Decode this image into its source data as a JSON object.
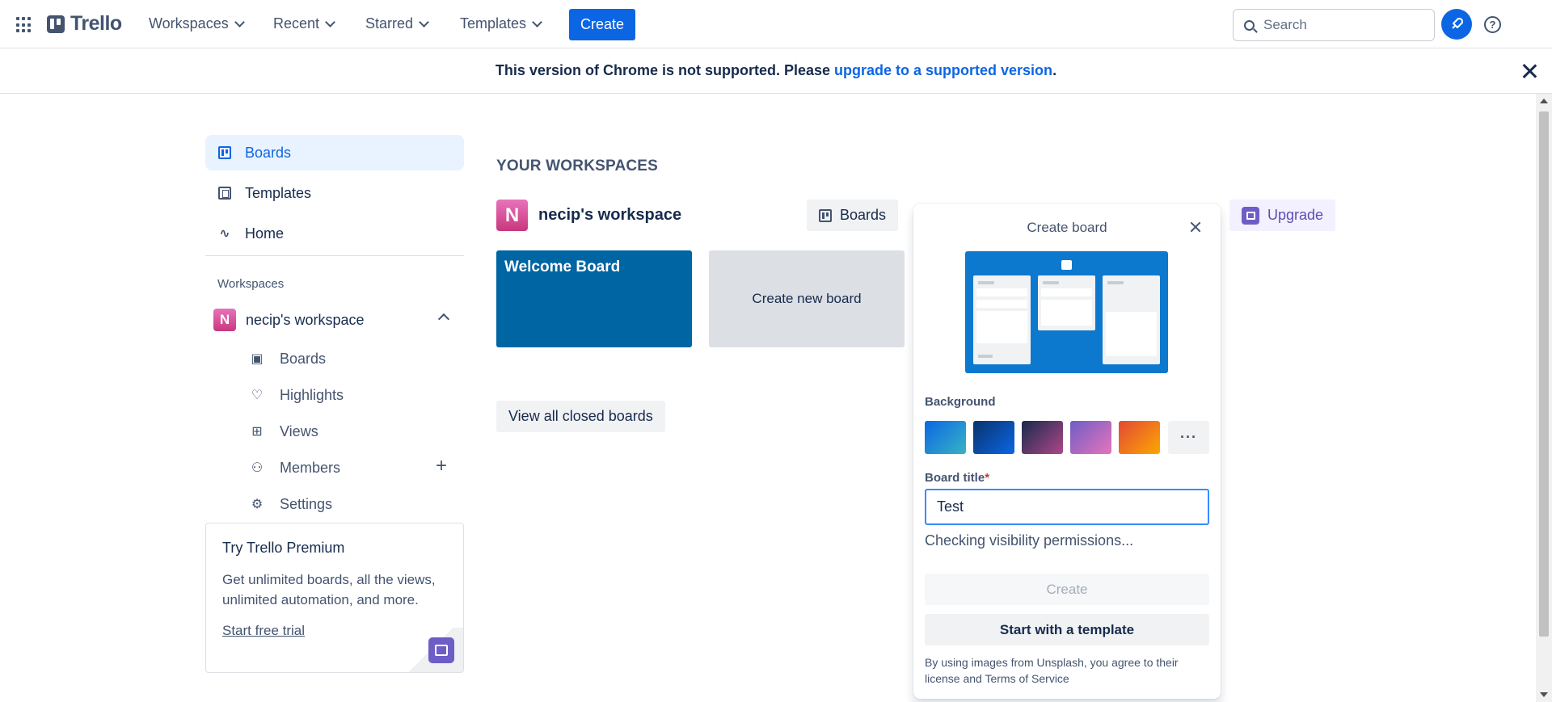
{
  "header": {
    "logo_text": "Trello",
    "nav": [
      "Workspaces",
      "Recent",
      "Starred",
      "Templates"
    ],
    "create_label": "Create",
    "search_placeholder": "Search",
    "help_glyph": "?"
  },
  "banner": {
    "text_before": "This version of Chrome is not supported. Please ",
    "link_text": "upgrade to a supported version",
    "text_after": "."
  },
  "sidebar": {
    "items": [
      {
        "label": "Boards",
        "icon": "board-icon",
        "active": true
      },
      {
        "label": "Templates",
        "icon": "templates-icon",
        "active": false
      },
      {
        "label": "Home",
        "icon": "pulse-icon",
        "active": false
      }
    ],
    "workspaces_heading": "Workspaces",
    "workspace_initial": "N",
    "workspace_name": "necip's workspace",
    "sub_items": [
      {
        "label": "Boards",
        "icon": "board-icon"
      },
      {
        "label": "Highlights",
        "icon": "heart-icon"
      },
      {
        "label": "Views",
        "icon": "grid-icon"
      },
      {
        "label": "Members",
        "icon": "members-icon"
      },
      {
        "label": "Settings",
        "icon": "gear-icon"
      }
    ],
    "premium": {
      "title": "Try Trello Premium",
      "description": "Get unlimited boards, all the views, unlimited automation, and more.",
      "link": "Start free trial"
    }
  },
  "main": {
    "heading": "YOUR WORKSPACES",
    "workspace_initial": "N",
    "workspace_name": "necip's workspace",
    "boards_button": "Boards",
    "upgrade_button": "Upgrade",
    "board_tile": "Welcome Board",
    "create_tile": "Create new board",
    "closed_boards_button": "View all closed boards"
  },
  "create_board": {
    "title": "Create board",
    "background_label": "Background",
    "swatches": [
      {
        "name": "blue-gradient",
        "colors": [
          "#0c66e4",
          "#37b4c3"
        ]
      },
      {
        "name": "dark-blue",
        "colors": [
          "#09326c",
          "#0c66e4"
        ]
      },
      {
        "name": "purple-night",
        "colors": [
          "#172b4d",
          "#ae4787"
        ]
      },
      {
        "name": "violet",
        "colors": [
          "#6e5dc6",
          "#e774bb"
        ]
      },
      {
        "name": "sunset",
        "colors": [
          "#e34935",
          "#fca700"
        ]
      }
    ],
    "more_label": "···",
    "board_title_label": "Board title",
    "required_marker": "*",
    "board_title_value": "Test",
    "status": "Checking visibility permissions...",
    "create_label": "Create",
    "template_label": "Start with a template",
    "footer": "By using images from Unsplash, you agree to their license and Terms of Service",
    "accent": "#0c79ce"
  }
}
